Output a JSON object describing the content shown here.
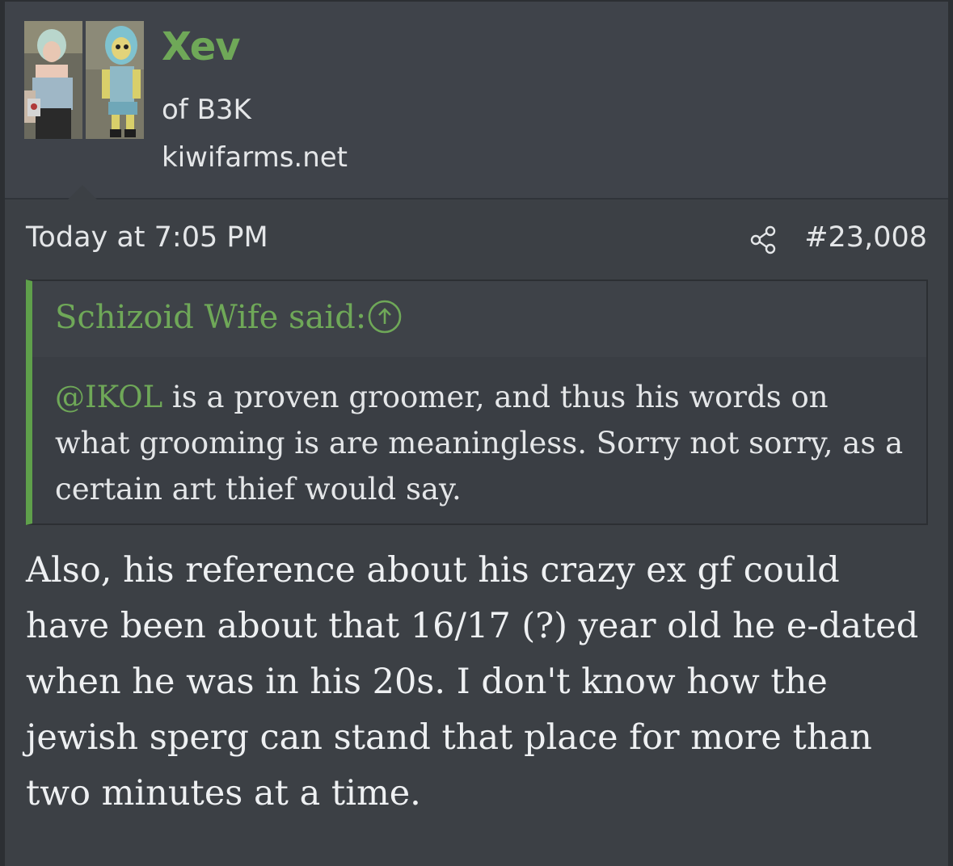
{
  "user": {
    "name": "Xev",
    "title": "of B3K",
    "site": "kiwifarms.net",
    "name_color": "#6fa858"
  },
  "post": {
    "date": "Today at 7:05 PM",
    "number": "#23,008",
    "share_icon": "share-icon"
  },
  "quote": {
    "author": "Schizoid Wife said:",
    "jump_icon": "arrow-up-circle-icon",
    "mention": "@IKOL",
    "text": " is a proven groomer, and thus his words on what grooming is are meaningless. Sorry not sorry, as a certain art thief would say.",
    "accent_color": "#5fa04b"
  },
  "body": {
    "text": "Also, his reference about his crazy ex gf could have been about that 16/17 (?) year old he e-dated when he was in his 20s. I don't know how the jewish sperg can stand that place for more than two minutes at a time."
  }
}
